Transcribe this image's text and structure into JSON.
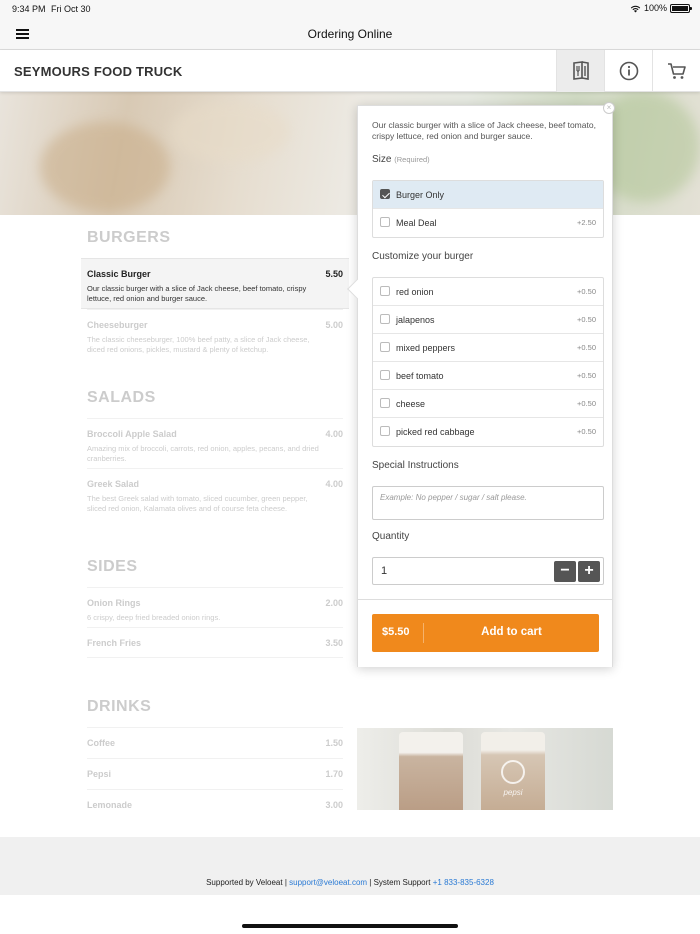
{
  "status_bar": {
    "time": "9:34 PM",
    "date": "Fri Oct 30",
    "battery": "100%"
  },
  "nav": {
    "title": "Ordering Online"
  },
  "header": {
    "shop_name": "SEYMOURS FOOD TRUCK"
  },
  "menu": {
    "categories": [
      {
        "name": "BURGERS",
        "items": [
          {
            "name": "Classic Burger",
            "price": "5.50",
            "desc": "Our classic burger with a slice of Jack cheese, beef tomato, crispy lettuce, red onion and burger sauce."
          },
          {
            "name": "Cheeseburger",
            "price": "5.00",
            "desc": "The classic cheeseburger, 100% beef patty, a slice of Jack cheese, diced red onions, pickles, mustard & plenty of ketchup."
          }
        ]
      },
      {
        "name": "SALADS",
        "items": [
          {
            "name": "Broccoli Apple Salad",
            "price": "4.00",
            "desc": "Amazing mix of broccoli, carrots, red onion, apples, pecans, and dried cranberries."
          },
          {
            "name": "Greek Salad",
            "price": "4.00",
            "desc": "The best Greek salad with tomato, sliced cucumber, green pepper, sliced red onion, Kalamata olives and of course feta cheese."
          }
        ]
      },
      {
        "name": "SIDES",
        "items": [
          {
            "name": "Onion Rings",
            "price": "2.00",
            "desc": "6 crispy, deep fried breaded onion rings."
          },
          {
            "name": "French Fries",
            "price": "3.50",
            "desc": ""
          }
        ]
      },
      {
        "name": "DRINKS",
        "items": [
          {
            "name": "Coffee",
            "price": "1.50",
            "desc": ""
          },
          {
            "name": "Pepsi",
            "price": "1.70",
            "desc": ""
          },
          {
            "name": "Lemonade",
            "price": "3.00",
            "desc": ""
          }
        ]
      }
    ],
    "drink_image_label": "pepsi"
  },
  "popover": {
    "desc": "Our classic burger with a slice of Jack cheese, beef tomato, crispy lettuce, red onion and burger sauce.",
    "size_label": "Size",
    "size_required": "(Required)",
    "size_options": [
      {
        "label": "Burger Only",
        "price": "",
        "checked": true
      },
      {
        "label": "Meal Deal",
        "price": "+2.50",
        "checked": false
      }
    ],
    "customize_label": "Customize your burger",
    "customize_options": [
      {
        "label": "red onion",
        "price": "+0.50"
      },
      {
        "label": "jalapenos",
        "price": "+0.50"
      },
      {
        "label": "mixed peppers",
        "price": "+0.50"
      },
      {
        "label": "beef tomato",
        "price": "+0.50"
      },
      {
        "label": "cheese",
        "price": "+0.50"
      },
      {
        "label": "picked red cabbage",
        "price": "+0.50"
      }
    ],
    "instructions_label": "Special Instructions",
    "instructions_placeholder": "Example: No pepper / sugar / salt please.",
    "quantity_label": "Quantity",
    "quantity": "1",
    "minus": "−",
    "plus": "+",
    "total": "$5.50",
    "add_label": "Add to cart",
    "close": "×"
  },
  "footer": {
    "prefix": "Supported by Veloeat | ",
    "email": "support@veloeat.com",
    "middle": " | System Support ",
    "phone": "+1 833-835-6328"
  },
  "colors": {
    "accent": "#f0891c",
    "link": "#2a7ad4",
    "selected_bg": "#dfeaf3"
  },
  "icons": [
    "hamburger-icon",
    "wifi-icon",
    "battery-icon",
    "menu-book-icon",
    "info-icon",
    "cart-icon",
    "checkmark-icon",
    "close-icon"
  ]
}
